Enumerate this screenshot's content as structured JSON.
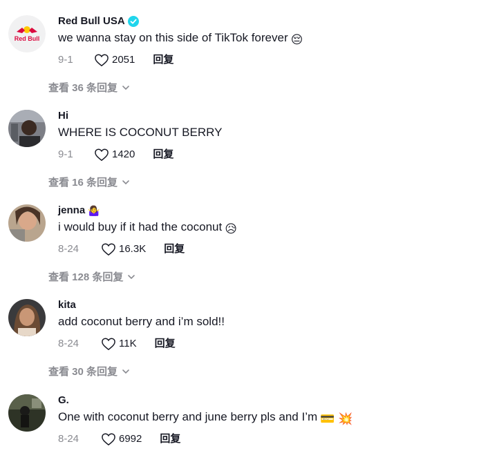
{
  "comments": [
    {
      "username": "Red Bull USA",
      "verified": true,
      "avatar_label": "Red Bull",
      "text": "we wanna stay on this side of TikTok forever",
      "emoji": "😔",
      "date": "9-1",
      "likes": "2051",
      "reply_label": "回复",
      "view_replies": "查看 36 条回复"
    },
    {
      "username": "Hi",
      "verified": false,
      "text": "WHERE IS COCONUT BERRY",
      "emoji": "",
      "date": "9-1",
      "likes": "1420",
      "reply_label": "回复",
      "view_replies": "查看 16 条回复"
    },
    {
      "username": "jenna",
      "username_emoji": "🤷‍♀️",
      "verified": false,
      "text": "i would buy if it had the coconut",
      "emoji": "😥",
      "date": "8-24",
      "likes": "16.3K",
      "reply_label": "回复",
      "view_replies": "查看 128 条回复"
    },
    {
      "username": "kita",
      "verified": false,
      "text": "add coconut berry and i’m sold!!",
      "emoji": "",
      "date": "8-24",
      "likes": "11K",
      "reply_label": "回复",
      "view_replies": "查看 30 条回复"
    },
    {
      "username": "G.",
      "verified": false,
      "text": "One with coconut berry and june berry pls and I’m",
      "emoji": "💳 💥",
      "date": "8-24",
      "likes": "6992",
      "reply_label": "回复",
      "view_replies": ""
    }
  ],
  "colors": {
    "text_primary": "#161823",
    "text_secondary": "#8a8b91",
    "verified": "#20d5ec",
    "redbull_red": "#db0a40",
    "redbull_yellow": "#ffc906"
  }
}
